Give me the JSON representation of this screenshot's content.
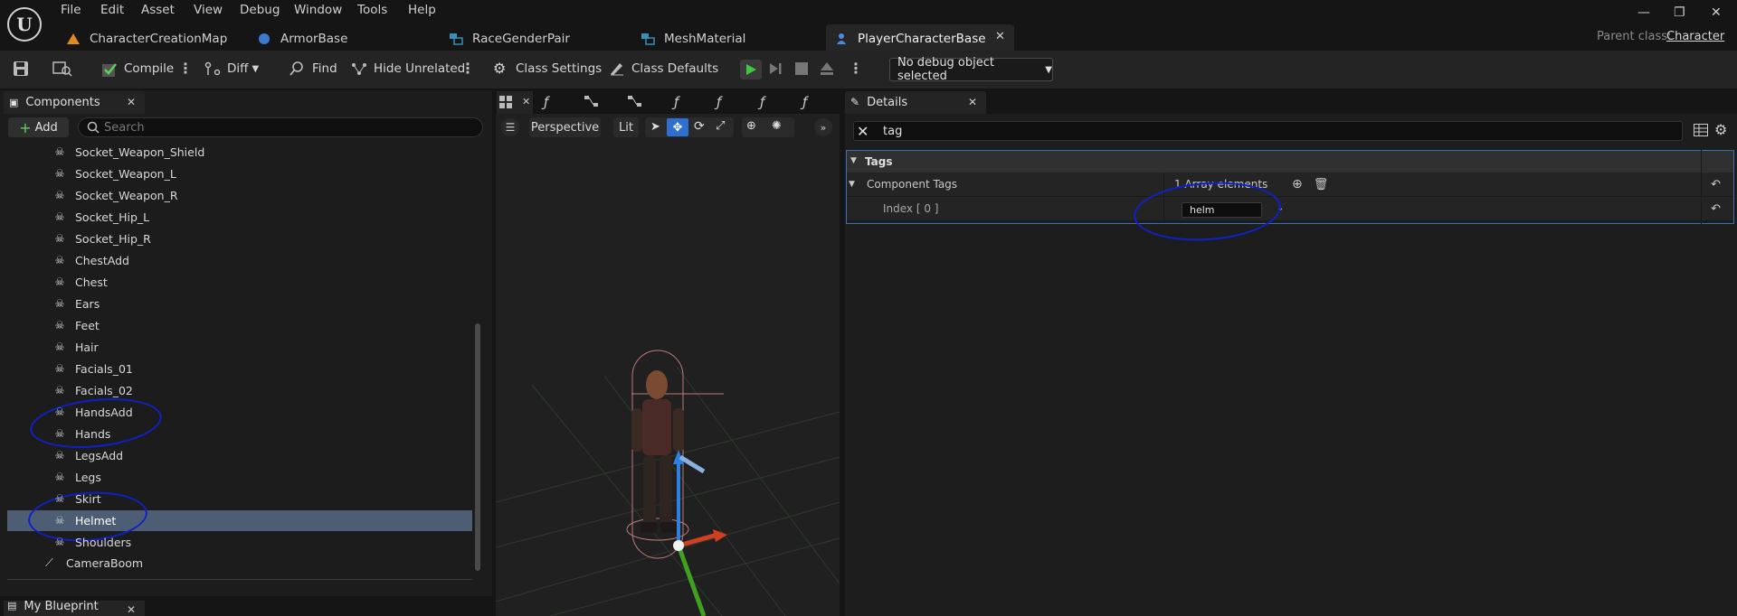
{
  "menu": [
    "File",
    "Edit",
    "Asset",
    "View",
    "Debug",
    "Window",
    "Tools",
    "Help"
  ],
  "tabs": [
    {
      "label": "CharacterCreationMap",
      "icon": "map-icon"
    },
    {
      "label": "ArmorBase",
      "icon": "blueprint-icon"
    },
    {
      "label": "RaceGenderPair",
      "icon": "struct-icon"
    },
    {
      "label": "MeshMaterial",
      "icon": "struct-icon"
    },
    {
      "label": "PlayerCharacterBase",
      "icon": "character-blueprint-icon",
      "active": true
    }
  ],
  "parent_class": {
    "label": "Parent class:",
    "value": "Character"
  },
  "toolbar": {
    "compile": "Compile",
    "diff": "Diff",
    "find": "Find",
    "hide_unrelated": "Hide Unrelated",
    "class_settings": "Class Settings",
    "class_defaults": "Class Defaults",
    "debug_object": "No debug object selected"
  },
  "components": {
    "tab_label": "Components",
    "add_label": "Add",
    "search_placeholder": "Search",
    "items": [
      "Socket_Weapon_Shield",
      "Socket_Weapon_L",
      "Socket_Weapon_R",
      "Socket_Hip_L",
      "Socket_Hip_R",
      "ChestAdd",
      "Chest",
      "Ears",
      "Feet",
      "Hair",
      "Facials_01",
      "Facials_02",
      "HandsAdd",
      "Hands",
      "LegsAdd",
      "Legs",
      "Skirt",
      "Helmet",
      "Shoulders"
    ],
    "selected": "Helmet",
    "camera_boom": "CameraBoom"
  },
  "my_blueprint": {
    "tab_label": "My Blueprint"
  },
  "viewport": {
    "perspective": "Perspective",
    "lit": "Lit"
  },
  "details": {
    "tab_label": "Details",
    "search_value": "tag",
    "section": "Tags",
    "component_tags_label": "Component Tags",
    "array_count": "1 Array elements",
    "index_label": "Index [ 0 ]",
    "index_value": "helm"
  },
  "colors": {
    "selection": "#4d5e74",
    "annotation": "#1020c8",
    "focus": "#3a6fb0"
  }
}
